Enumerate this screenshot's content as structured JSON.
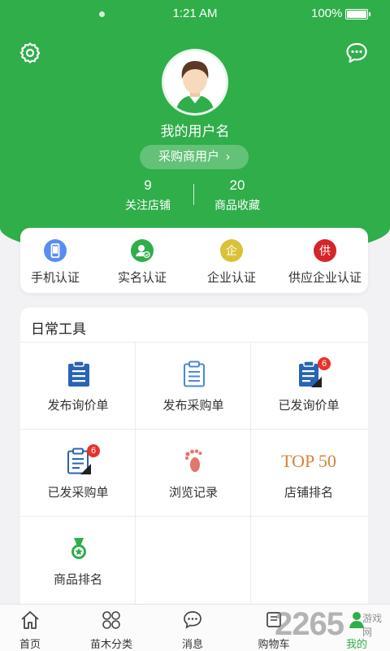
{
  "status": {
    "time": "1:21 AM",
    "battery": "100%"
  },
  "profile": {
    "username": "我的用户名",
    "role": "采购商用户",
    "role_chevron": "›",
    "stats": [
      {
        "value": "9",
        "label": "关注店铺"
      },
      {
        "value": "20",
        "label": "商品收藏"
      }
    ]
  },
  "certifications": [
    {
      "label": "手机认证",
      "icon": "phone-icon",
      "glyph": "",
      "color": "#5b8def"
    },
    {
      "label": "实名认证",
      "icon": "person-check-icon",
      "glyph": "",
      "color": "#2fae4a"
    },
    {
      "label": "企业认证",
      "icon": "enterprise-icon",
      "glyph": "企",
      "color": "#d9c23a"
    },
    {
      "label": "供应企业认证",
      "icon": "supplier-icon",
      "glyph": "供",
      "color": "#d4262a"
    }
  ],
  "tools": {
    "title": "日常工具",
    "items": [
      {
        "label": "发布询价单",
        "icon": "clipboard-icon"
      },
      {
        "label": "发布采购单",
        "icon": "clipboard-outline-icon"
      },
      {
        "label": "已发询价单",
        "icon": "clipboard-sent-icon",
        "badge": "6"
      },
      {
        "label": "已发采购单",
        "icon": "clipboard-sent-icon",
        "badge": "6"
      },
      {
        "label": "浏览记录",
        "icon": "footprint-icon"
      },
      {
        "label": "店铺排名",
        "icon": "top50-icon",
        "logo_text": "TOP 50"
      },
      {
        "label": "商品排名",
        "icon": "medal-icon"
      }
    ]
  },
  "tabbar": [
    {
      "label": "首页",
      "icon": "home-icon"
    },
    {
      "label": "苗木分类",
      "icon": "category-icon"
    },
    {
      "label": "消息",
      "icon": "message-icon"
    },
    {
      "label": "购物车",
      "icon": "cart-icon"
    },
    {
      "label": "我的",
      "icon": "profile-icon",
      "active": true
    }
  ],
  "watermark": {
    "text": "2265",
    "sub": "游戏网"
  },
  "colors": {
    "brand": "#2fae4a",
    "badge": "#e8322b",
    "top50": "#d4843a"
  }
}
